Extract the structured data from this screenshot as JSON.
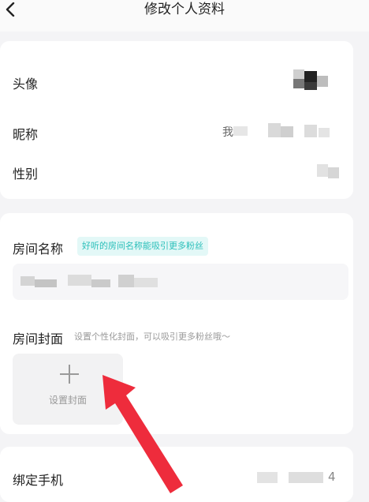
{
  "header": {
    "back_icon": "chevron-left-icon",
    "title": "修改个人资料"
  },
  "profile": {
    "avatar_label": "头像",
    "nickname_label": "昵称",
    "nickname_value_partial": "我",
    "gender_label": "性别"
  },
  "room": {
    "name_label": "房间名称",
    "name_tip": "好听的房间名称能吸引更多粉丝",
    "cover_label": "房间封面",
    "cover_hint": "设置个性化封面，可以吸引更多粉丝哦～",
    "cover_button_label": "设置封面",
    "cover_button_icon": "plus-icon"
  },
  "account": {
    "phone_label": "绑定手机",
    "phone_value_partial": "4"
  },
  "annotation": {
    "arrow_icon": "red-arrow-icon",
    "arrow_color": "#ee2c3c"
  }
}
